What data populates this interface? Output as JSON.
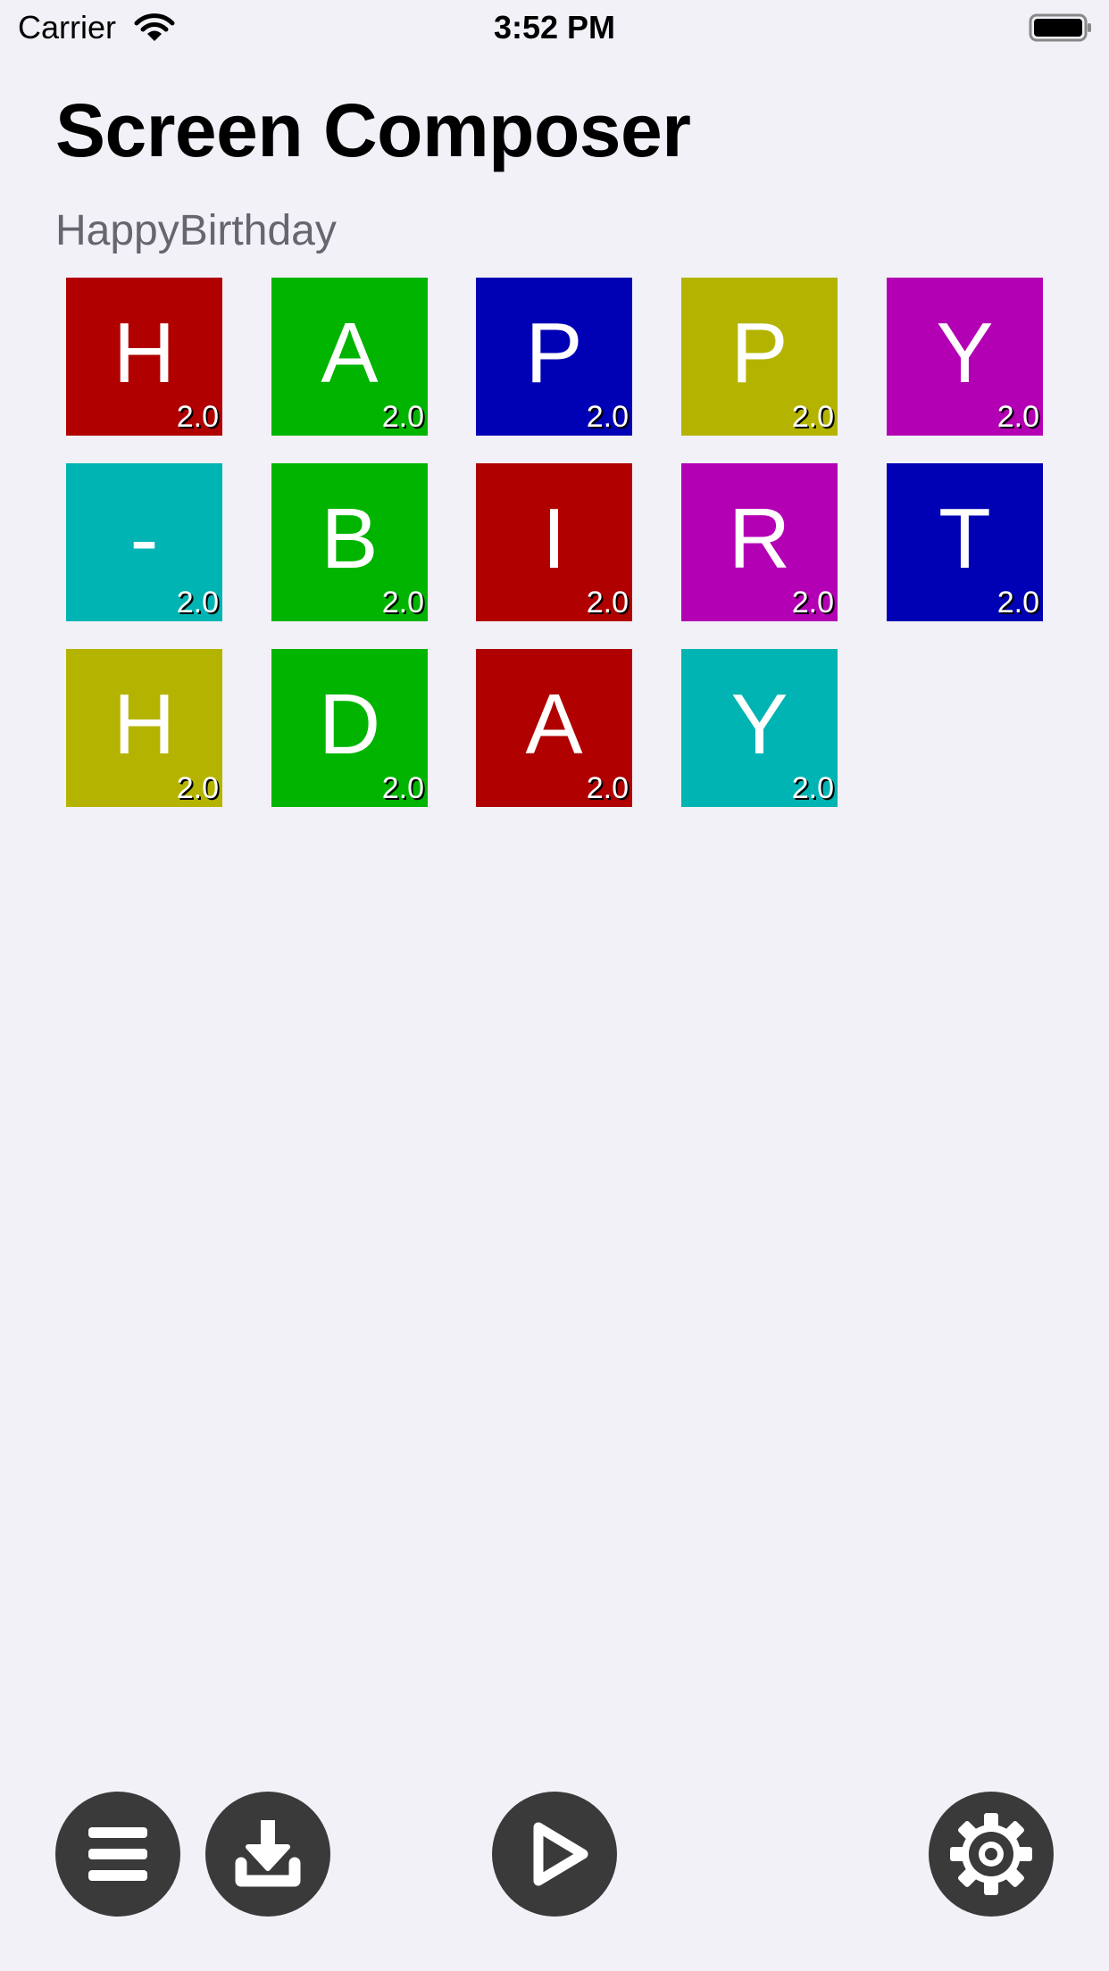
{
  "status_bar": {
    "carrier": "Carrier",
    "time": "3:52 PM",
    "wifi_icon": "wifi-icon",
    "battery_icon": "battery-icon"
  },
  "header": {
    "title": "Screen Composer",
    "composition_name": "HappyBirthday"
  },
  "tiles": [
    {
      "letter": "H",
      "value": "2.0",
      "color": "#b00000"
    },
    {
      "letter": "A",
      "value": "2.0",
      "color": "#00b400"
    },
    {
      "letter": "P",
      "value": "2.0",
      "color": "#0000b4"
    },
    {
      "letter": "P",
      "value": "2.0",
      "color": "#b4b400"
    },
    {
      "letter": "Y",
      "value": "2.0",
      "color": "#b400b4"
    },
    {
      "letter": "-",
      "value": "2.0",
      "color": "#00b4b4"
    },
    {
      "letter": "B",
      "value": "2.0",
      "color": "#00b400"
    },
    {
      "letter": "I",
      "value": "2.0",
      "color": "#b00000"
    },
    {
      "letter": "R",
      "value": "2.0",
      "color": "#b400b4"
    },
    {
      "letter": "T",
      "value": "2.0",
      "color": "#0000b4"
    },
    {
      "letter": "H",
      "value": "2.0",
      "color": "#b4b400"
    },
    {
      "letter": "D",
      "value": "2.0",
      "color": "#00b400"
    },
    {
      "letter": "A",
      "value": "2.0",
      "color": "#b00000"
    },
    {
      "letter": "Y",
      "value": "2.0",
      "color": "#00b4b4"
    }
  ],
  "toolbar": {
    "menu_icon": "hamburger-menu-icon",
    "download_icon": "download-icon",
    "play_icon": "play-icon",
    "settings_icon": "gear-icon",
    "button_color": "#3a3a3a"
  }
}
